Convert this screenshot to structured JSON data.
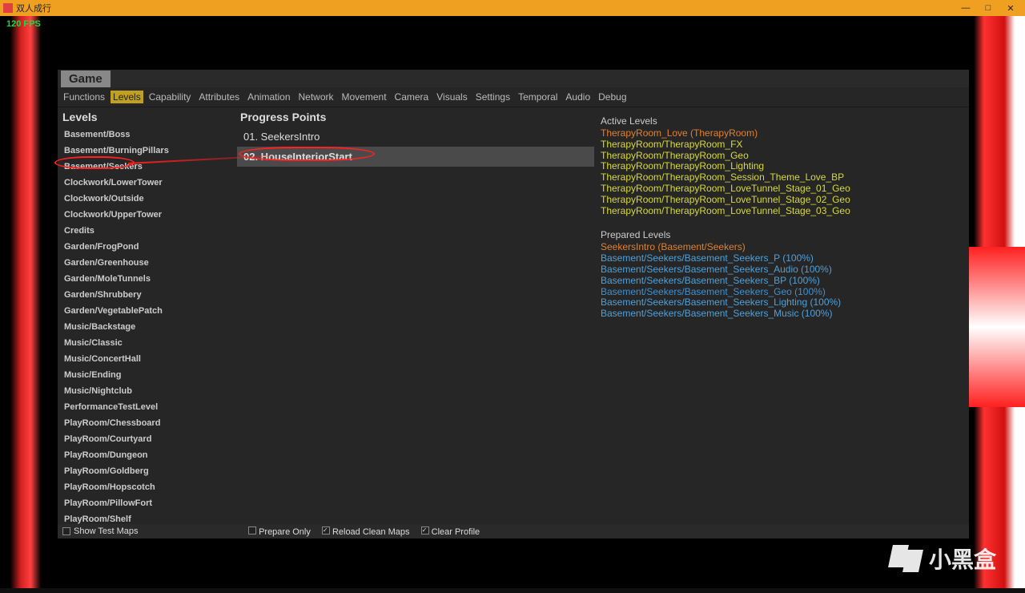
{
  "window": {
    "title": "双人成行",
    "fps": "120 FPS"
  },
  "panel": {
    "game_tab": "Game",
    "menu": [
      "Functions",
      "Levels",
      "Capability",
      "Attributes",
      "Animation",
      "Network",
      "Movement",
      "Camera",
      "Visuals",
      "Settings",
      "Temporal",
      "Audio",
      "Debug"
    ],
    "menu_active_index": 1
  },
  "levels_header": "Levels",
  "levels": [
    "Basement/Boss",
    "Basement/BurningPillars",
    "Basement/Seekers",
    "Clockwork/LowerTower",
    "Clockwork/Outside",
    "Clockwork/UpperTower",
    "Credits",
    "Garden/FrogPond",
    "Garden/Greenhouse",
    "Garden/MoleTunnels",
    "Garden/Shrubbery",
    "Garden/VegetablePatch",
    "Music/Backstage",
    "Music/Classic",
    "Music/ConcertHall",
    "Music/Ending",
    "Music/Nightclub",
    "PerformanceTestLevel",
    "PlayRoom/Chessboard",
    "PlayRoom/Courtyard",
    "PlayRoom/Dungeon",
    "PlayRoom/Goldberg",
    "PlayRoom/Hopscotch",
    "PlayRoom/PillowFort",
    "PlayRoom/Shelf"
  ],
  "progress_header": "Progress Points",
  "progress": [
    {
      "label": "01.  SeekersIntro",
      "selected": false
    },
    {
      "label": "02.  HouseInteriorStart",
      "selected": true
    }
  ],
  "active_levels_header": "Active Levels",
  "active_levels": [
    {
      "text": "TherapyRoom_Love (TherapyRoom)",
      "cls": "c-orange"
    },
    {
      "text": "TherapyRoom/TherapyRoom_FX",
      "cls": "c-yellow"
    },
    {
      "text": "TherapyRoom/TherapyRoom_Geo",
      "cls": "c-yellow"
    },
    {
      "text": "TherapyRoom/TherapyRoom_Lighting",
      "cls": "c-yellow"
    },
    {
      "text": "TherapyRoom/TherapyRoom_Session_Theme_Love_BP",
      "cls": "c-yellow"
    },
    {
      "text": "TherapyRoom/TherapyRoom_LoveTunnel_Stage_01_Geo",
      "cls": "c-yellow"
    },
    {
      "text": "TherapyRoom/TherapyRoom_LoveTunnel_Stage_02_Geo",
      "cls": "c-yellow"
    },
    {
      "text": "TherapyRoom/TherapyRoom_LoveTunnel_Stage_03_Geo",
      "cls": "c-yellow"
    }
  ],
  "prepared_levels_header": "Prepared Levels",
  "prepared_levels": [
    {
      "text": "SeekersIntro (Basement/Seekers)",
      "cls": "c-orange"
    },
    {
      "text": "Basement/Seekers/Basement_Seekers_P (100%)",
      "cls": "c-blue"
    },
    {
      "text": "Basement/Seekers/Basement_Seekers_Audio (100%)",
      "cls": "c-blue"
    },
    {
      "text": "Basement/Seekers/Basement_Seekers_BP (100%)",
      "cls": "c-blue"
    },
    {
      "text": "Basement/Seekers/Basement_Seekers_Geo (100%)",
      "cls": "c-blue2"
    },
    {
      "text": "Basement/Seekers/Basement_Seekers_Lighting (100%)",
      "cls": "c-blue"
    },
    {
      "text": "Basement/Seekers/Basement_Seekers_Music (100%)",
      "cls": "c-blue"
    }
  ],
  "footer": {
    "show_test_maps": {
      "label": "Show Test Maps",
      "checked": false
    },
    "prepare_only": {
      "label": "Prepare Only",
      "checked": false
    },
    "reload_clean_maps": {
      "label": "Reload Clean Maps",
      "checked": true
    },
    "clear_profile": {
      "label": "Clear Profile",
      "checked": true
    }
  },
  "watermark": "小黑盒"
}
